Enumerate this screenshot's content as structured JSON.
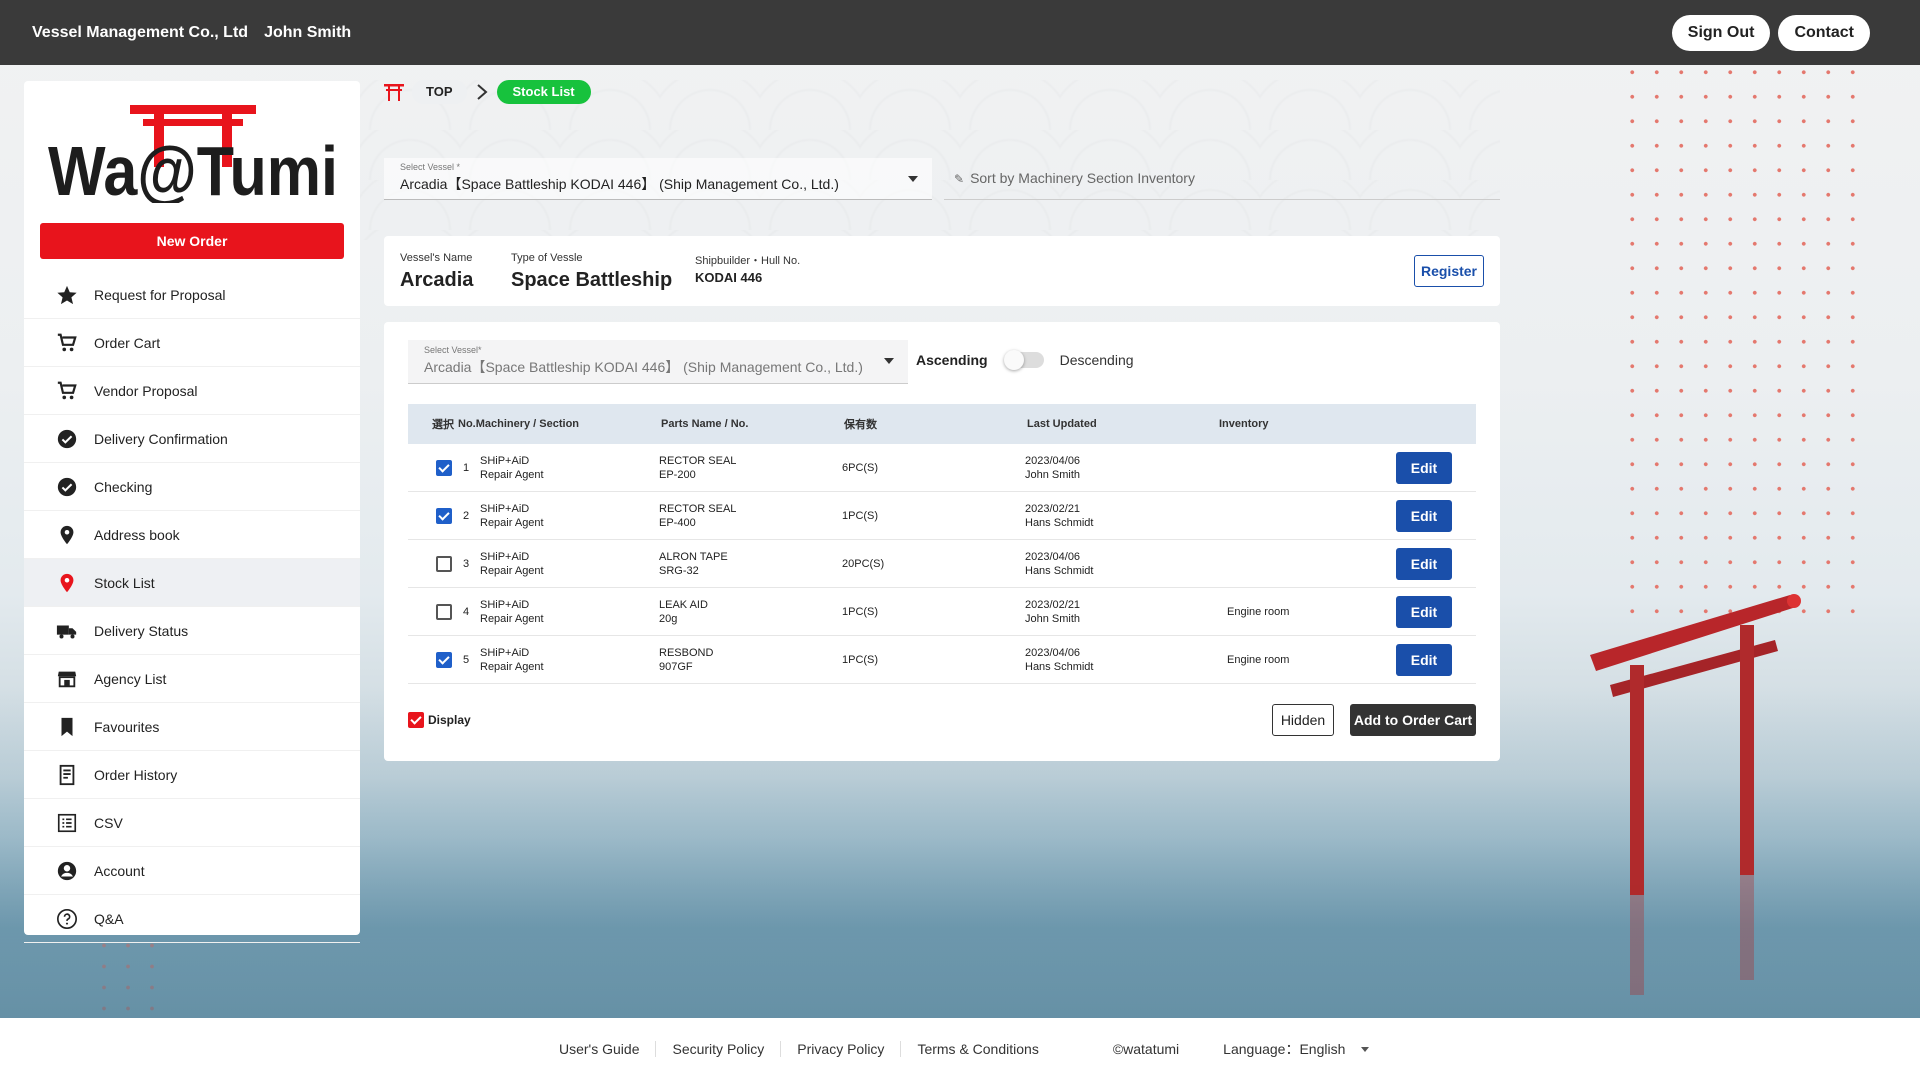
{
  "header": {
    "company": "Vessel Management Co., Ltd",
    "user": "John Smith",
    "sign_out": "Sign Out",
    "contact": "Contact"
  },
  "sidebar": {
    "logo_text": "Wa@Tumi",
    "new_order": "New Order",
    "items": [
      {
        "label": "Request for Proposal",
        "icon": "star-icon"
      },
      {
        "label": "Order Cart",
        "icon": "cart-icon"
      },
      {
        "label": "Vendor Proposal",
        "icon": "cart-icon"
      },
      {
        "label": "Delivery Confirmation",
        "icon": "check-circle-icon"
      },
      {
        "label": "Checking",
        "icon": "check-circle-icon"
      },
      {
        "label": "Address book",
        "icon": "location-pin-icon"
      },
      {
        "label": "Stock List",
        "icon": "location-pin-icon",
        "active": true
      },
      {
        "label": "Delivery Status",
        "icon": "truck-icon"
      },
      {
        "label": "Agency List",
        "icon": "store-icon"
      },
      {
        "label": "Favourites",
        "icon": "bookmark-icon"
      },
      {
        "label": "Order History",
        "icon": "receipt-icon"
      },
      {
        "label": "CSV",
        "icon": "list-icon"
      },
      {
        "label": "Account",
        "icon": "account-icon"
      },
      {
        "label": "Q&A",
        "icon": "help-icon"
      }
    ]
  },
  "breadcrumb": {
    "top": "TOP",
    "current": "Stock List"
  },
  "vessel_select": {
    "label": "Select Vessel *",
    "value": "Arcadia【Space Battleship KODAI 446】 (Ship Management Co., Ltd.)"
  },
  "sort": {
    "placeholder": "Sort by Machinery Section Inventory"
  },
  "vessel_info": {
    "name_label": "Vessel's Name",
    "name": "Arcadia",
    "type_label": "Type of Vessle",
    "type": "Space Battleship",
    "builder_label": "Shipbuilder・Hull No.",
    "builder": "KODAI 446",
    "register": "Register"
  },
  "list": {
    "select_label": "Select Vessel*",
    "select_value": "Arcadia【Space Battleship KODAI 446】 (Ship Management Co., Ltd.)",
    "ascending": "Ascending",
    "descending": "Descending",
    "sort_descending": false,
    "columns": {
      "select": "選択",
      "machinery": "No.Machinery / Section",
      "parts": "Parts Name / No.",
      "qty": "保有数",
      "updated": "Last Updated",
      "inventory": "Inventory"
    },
    "rows": [
      {
        "checked": true,
        "no": "1",
        "mach1": "SHiP+AiD",
        "mach2": "Repair Agent",
        "part1": "RECTOR SEAL",
        "part2": "EP-200",
        "qty": "6PC(S)",
        "date": "2023/04/06",
        "by": "John Smith",
        "inventory": "",
        "edit": "Edit"
      },
      {
        "checked": true,
        "no": "2",
        "mach1": "SHiP+AiD",
        "mach2": "Repair Agent",
        "part1": "RECTOR SEAL",
        "part2": "EP-400",
        "qty": "1PC(S)",
        "date": "2023/02/21",
        "by": "Hans Schmidt",
        "inventory": "",
        "edit": "Edit"
      },
      {
        "checked": false,
        "no": "3",
        "mach1": "SHiP+AiD",
        "mach2": "Repair Agent",
        "part1": "ALRON TAPE",
        "part2": "SRG-32",
        "qty": "20PC(S)",
        "date": "2023/04/06",
        "by": "Hans Schmidt",
        "inventory": "",
        "edit": "Edit"
      },
      {
        "checked": false,
        "no": "4",
        "mach1": "SHiP+AiD",
        "mach2": "Repair Agent",
        "part1": "LEAK AID",
        "part2": "20g",
        "qty": "1PC(S)",
        "date": "2023/02/21",
        "by": "John Smith",
        "inventory": "Engine room",
        "edit": "Edit"
      },
      {
        "checked": true,
        "no": "5",
        "mach1": "SHiP+AiD",
        "mach2": "Repair Agent",
        "part1": "RESBOND",
        "part2": "907GF",
        "qty": "1PC(S)",
        "date": "2023/04/06",
        "by": "Hans Schmidt",
        "inventory": "Engine room",
        "edit": "Edit"
      }
    ],
    "display": "Display",
    "hidden": "Hidden",
    "add_to_cart": "Add to Order Cart"
  },
  "footer": {
    "links": [
      "User's Guide",
      "Security Policy",
      "Privacy Policy",
      "Terms & Conditions"
    ],
    "copyright": "©watatumi",
    "language": "Language：English"
  },
  "colors": {
    "header_bg": "#3a3a3a",
    "brand_red": "#e8141c",
    "breadcrumb_green": "#17c23d",
    "primary_blue": "#1a4faa",
    "checkbox_blue": "#1f5fc9"
  }
}
